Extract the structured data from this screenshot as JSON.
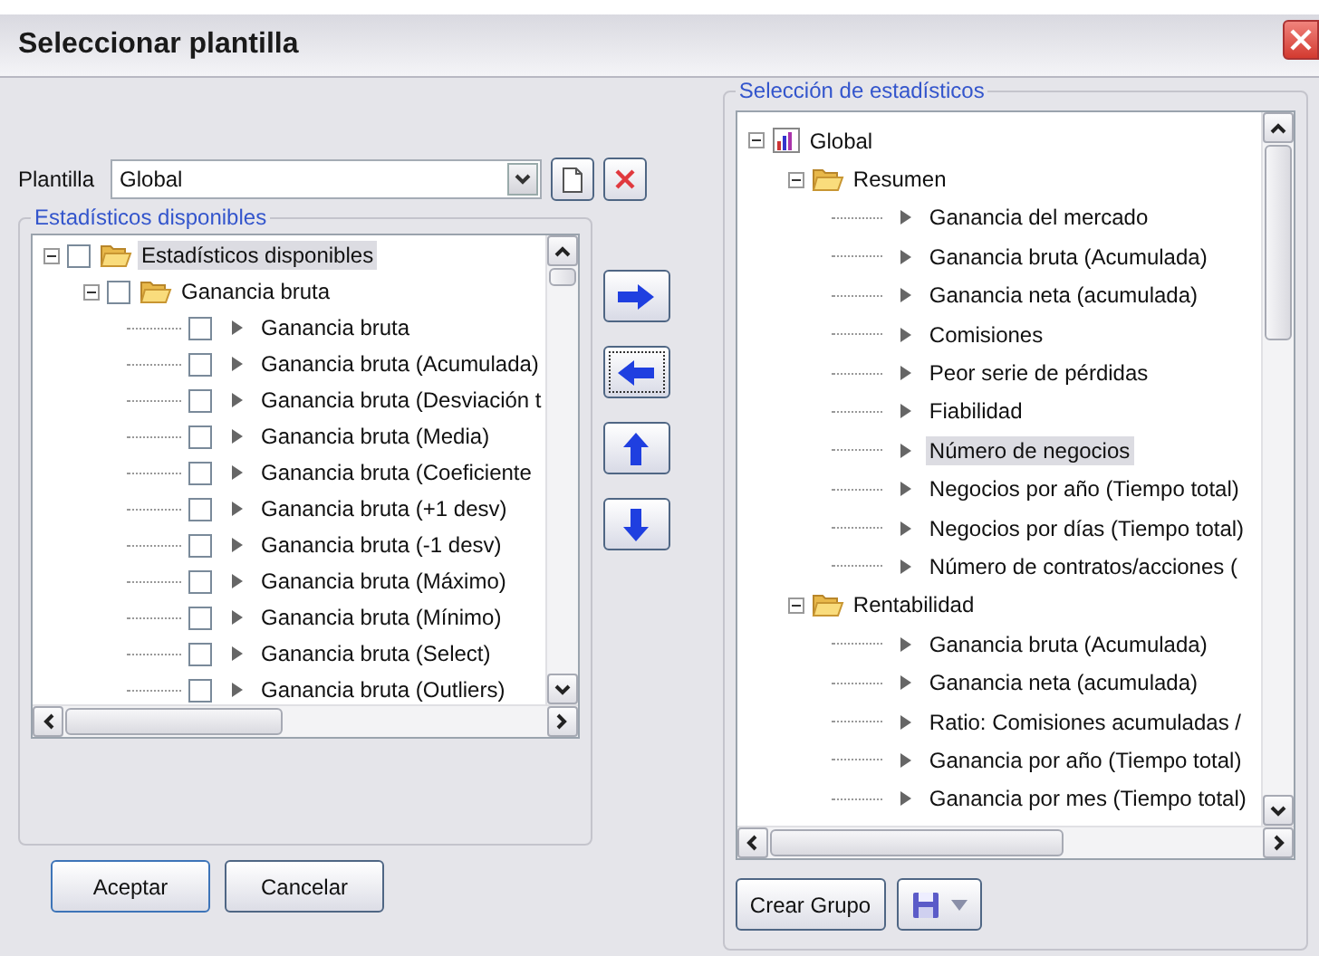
{
  "window": {
    "title": "Seleccionar plantilla"
  },
  "template": {
    "label": "Plantilla",
    "value": "Global"
  },
  "available": {
    "title": "Estadísticos disponibles",
    "tree": [
      {
        "label": "Estadísticos disponibles",
        "kind": "folder",
        "checked": false,
        "expanded": true,
        "selected": true,
        "children": [
          {
            "label": "Ganancia bruta",
            "kind": "folder",
            "checked": false,
            "expanded": true,
            "selected": false,
            "children": [
              {
                "label": "Ganancia bruta",
                "kind": "stat",
                "checked": false,
                "selected": false
              },
              {
                "label": "Ganancia bruta (Acumulada)",
                "kind": "stat",
                "checked": false,
                "selected": false
              },
              {
                "label": "Ganancia bruta (Desviación t",
                "kind": "stat",
                "checked": false,
                "selected": false
              },
              {
                "label": "Ganancia bruta (Media)",
                "kind": "stat",
                "checked": false,
                "selected": false
              },
              {
                "label": "Ganancia bruta (Coeficiente",
                "kind": "stat",
                "checked": false,
                "selected": false
              },
              {
                "label": "Ganancia bruta (+1 desv)",
                "kind": "stat",
                "checked": false,
                "selected": false
              },
              {
                "label": "Ganancia bruta (-1 desv)",
                "kind": "stat",
                "checked": false,
                "selected": false
              },
              {
                "label": "Ganancia bruta (Máximo)",
                "kind": "stat",
                "checked": false,
                "selected": false
              },
              {
                "label": "Ganancia bruta (Mínimo)",
                "kind": "stat",
                "checked": false,
                "selected": false
              },
              {
                "label": "Ganancia bruta (Select)",
                "kind": "stat",
                "checked": false,
                "selected": false
              },
              {
                "label": "Ganancia bruta (Outliers)",
                "kind": "stat",
                "checked": false,
                "selected": false
              }
            ]
          }
        ]
      }
    ]
  },
  "selection": {
    "title": "Selección de estadísticos",
    "tree": [
      {
        "label": "Global",
        "kind": "root",
        "expanded": true,
        "selected": false,
        "children": [
          {
            "label": "Resumen",
            "kind": "folder",
            "expanded": true,
            "selected": false,
            "children": [
              {
                "label": "Ganancia del mercado",
                "kind": "stat",
                "selected": false
              },
              {
                "label": "Ganancia bruta (Acumulada)",
                "kind": "stat",
                "selected": false
              },
              {
                "label": "Ganancia neta (acumulada)",
                "kind": "stat",
                "selected": false
              },
              {
                "label": "Comisiones",
                "kind": "stat",
                "selected": false
              },
              {
                "label": "Peor serie de pérdidas",
                "kind": "stat",
                "selected": false
              },
              {
                "label": "Fiabilidad",
                "kind": "stat",
                "selected": false
              },
              {
                "label": "Número de negocios",
                "kind": "stat",
                "selected": true
              },
              {
                "label": "Negocios por año (Tiempo total)",
                "kind": "stat",
                "selected": false
              },
              {
                "label": "Negocios por días (Tiempo total)",
                "kind": "stat",
                "selected": false
              },
              {
                "label": "Número de contratos/acciones (",
                "kind": "stat",
                "selected": false
              }
            ]
          },
          {
            "label": "Rentabilidad",
            "kind": "folder",
            "expanded": true,
            "selected": false,
            "children": [
              {
                "label": "Ganancia bruta (Acumulada)",
                "kind": "stat",
                "selected": false
              },
              {
                "label": "Ganancia neta (acumulada)",
                "kind": "stat",
                "selected": false
              },
              {
                "label": "Ratio: Comisiones acumuladas /",
                "kind": "stat",
                "selected": false
              },
              {
                "label": "Ganancia por año (Tiempo total)",
                "kind": "stat",
                "selected": false
              },
              {
                "label": "Ganancia por mes (Tiempo total)",
                "kind": "stat",
                "selected": false
              }
            ]
          }
        ]
      }
    ]
  },
  "group_button": "Crear Grupo",
  "buttons": [
    "Aceptar",
    "Cancelar"
  ]
}
